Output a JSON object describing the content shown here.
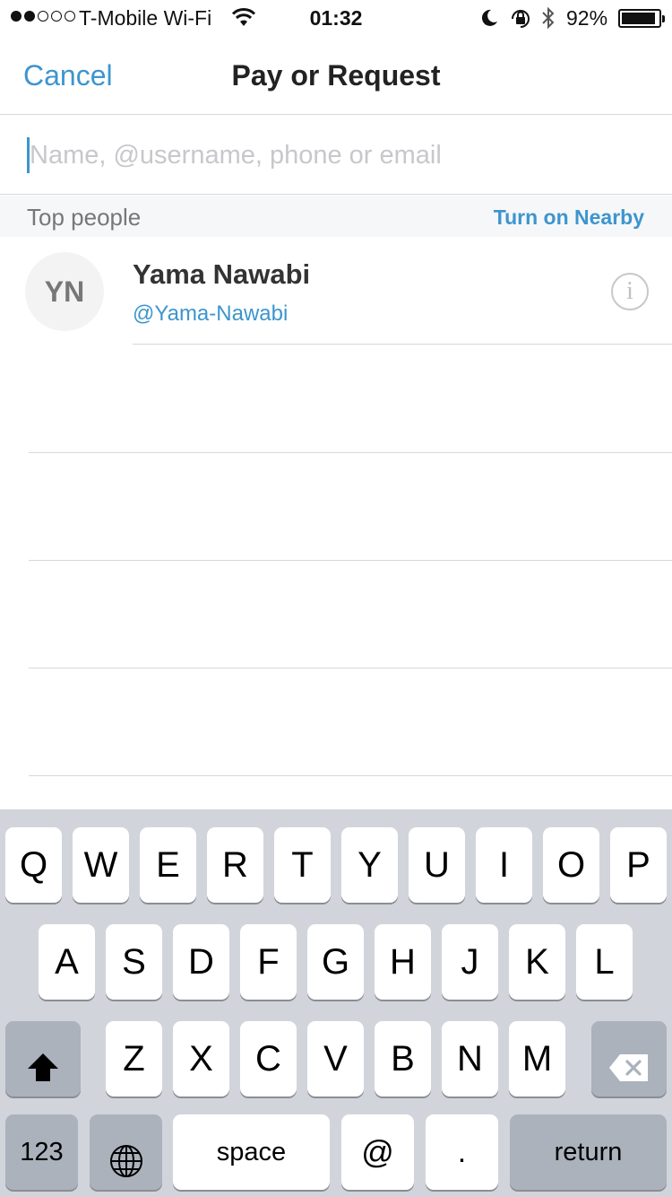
{
  "status_bar": {
    "carrier": "T-Mobile Wi-Fi",
    "time": "01:32",
    "battery_percent": "92%",
    "battery_level": 0.92,
    "icons": [
      "signal-dots-icon",
      "wifi-icon",
      "moon-icon",
      "rotation-lock-icon",
      "bluetooth-icon",
      "battery-icon"
    ]
  },
  "nav": {
    "cancel_label": "Cancel",
    "title": "Pay or Request"
  },
  "search": {
    "placeholder": "Name, @username, phone or email",
    "value": ""
  },
  "section": {
    "title": "Top people",
    "action_label": "Turn on Nearby"
  },
  "people": [
    {
      "initials": "YN",
      "name": "Yama Nawabi",
      "handle": "@Yama-Nawabi",
      "info_icon": "info-icon"
    }
  ],
  "keyboard": {
    "row1": [
      "Q",
      "W",
      "E",
      "R",
      "T",
      "Y",
      "U",
      "I",
      "O",
      "P"
    ],
    "row2": [
      "A",
      "S",
      "D",
      "F",
      "G",
      "H",
      "J",
      "K",
      "L"
    ],
    "row3": [
      "Z",
      "X",
      "C",
      "V",
      "B",
      "N",
      "M"
    ],
    "numbers_label": "123",
    "space_label": "space",
    "at_label": "@",
    "dot_label": ".",
    "return_label": "return"
  },
  "colors": {
    "accent": "#3d95ce",
    "keyboard_bg": "#d1d5db",
    "dark_key": "#abb2bc"
  }
}
